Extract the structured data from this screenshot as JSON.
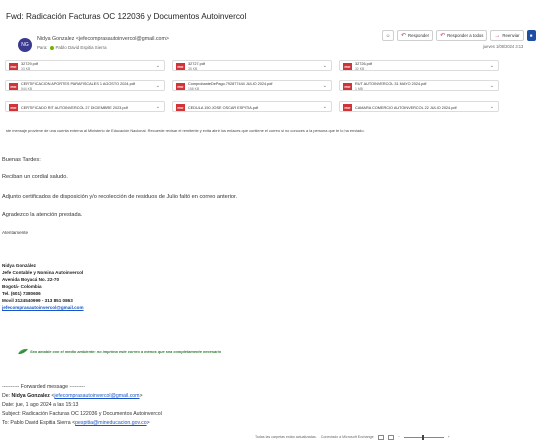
{
  "email": {
    "subject": "Fwd: Radicación Facturas OC 122036 y Documentos Autoinvercol",
    "avatar_initials": "NG",
    "sender": "Nidya Gonzalez <jefecomprasautoinvercol@gmail.com>",
    "to_label": "Para:",
    "to_name": "Pablo David Espitia Sierra",
    "date": "jueves 1/08/2024 3:13"
  },
  "actions": {
    "reply": "Responder",
    "reply_all": "Responder a todos",
    "forward": "Reenviar"
  },
  "attachments": [
    {
      "name": "32729.pdf",
      "size": "33 KB"
    },
    {
      "name": "32727.pdf",
      "size": "35 KB"
    },
    {
      "name": "32726.pdf",
      "size": "32 KB"
    },
    {
      "name": "CERTIFICACION APORTES PARAFISCALES 1 AGOSTO 2024.pdf",
      "size": "544 KB"
    },
    {
      "name": "ComprobanteDePago.792877444 JULIO 2024.pdf",
      "size": "158 KB"
    },
    {
      "name": "RUT AUTOINVERCOL 31 MAYO 2024.pdf",
      "size": "1 MB"
    },
    {
      "name": "CERTIFICADO RIT AUTOINVERCOL 27 DICIEMBRE 2023.pdf",
      "size": ""
    },
    {
      "name": "CEDULA 150 JOSE OSCAR ESPITIA.pdf",
      "size": ""
    },
    {
      "name": "CAMARA COMERCIO AUTOINVERCOL 22 JULIO 2024.pdf",
      "size": ""
    }
  ],
  "external_warning": "ste mensaje proviene de una cuenta externa al Ministerio de Educación Nacional. Recuerde revisar el remitente y evita abrir los enlaces que contiene el correo si no conoces a la persona que te lo ha enviado.",
  "body": {
    "greeting": "Buenas Tardes:",
    "cordial": "Reciban un cordial saludo.",
    "attached": "Adjunto certificados de disposición y/o recolección de residuos de Julio faltó en correo anterior.",
    "thanks": "Agradezco la atención prestada.",
    "closing": "Atentamente"
  },
  "signature": {
    "name": "Nidya González",
    "role": "Jefe Contable y Nomina Autoinvercol",
    "address": "Avenida Boyacá No. 22-70",
    "city": "Bogotá- Colombia",
    "tel": "Tel. (601) 7380606",
    "cell": "Movil 3124540999 - 313 851 0863",
    "email": "jefecomprasautoinvercol@gmail.com"
  },
  "eco_note": "Sea amable con el medio ambiente: no imprima este correo a menos que sea completamente necesario",
  "forwarded": {
    "header": "---------- Forwarded message ---------",
    "from_label": "De:",
    "from_name": "Nidya Gonzalez",
    "from_email": "jefecomprasautoinvercol@gmail.com",
    "date": "Date: jue, 1 ago 2024 a las 15:13",
    "subject": "Subject: Radicación Facturas OC 122036 y Documentos Autoinvercol",
    "to_label": "To: Pablo David Espitia Sierra",
    "to_email": "pespitia@mineducacion.gov.co"
  },
  "statusbar": {
    "sync": "Todas las carpetas están actualizadas.",
    "connected": "Conectado a Microsoft Exchange"
  }
}
